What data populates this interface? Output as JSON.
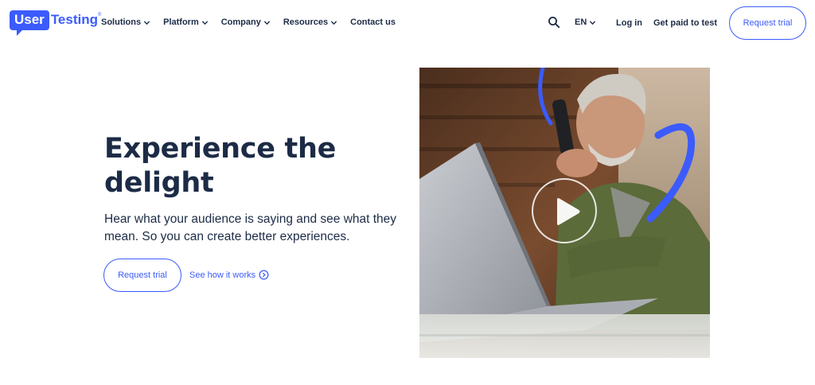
{
  "header": {
    "logo": {
      "part1": "User",
      "part2": "Testing",
      "reg": "®"
    },
    "nav": [
      {
        "label": "Solutions",
        "has_dropdown": true
      },
      {
        "label": "Platform",
        "has_dropdown": true
      },
      {
        "label": "Company",
        "has_dropdown": true
      },
      {
        "label": "Resources",
        "has_dropdown": true
      },
      {
        "label": "Contact us",
        "has_dropdown": false
      }
    ],
    "language": "EN",
    "login_label": "Log in",
    "get_paid_label": "Get paid to test",
    "cta_label": "Request trial"
  },
  "hero": {
    "headline": "Experience the delight",
    "subtext": "Hear what your audience is saying and see what they mean. So you can create better experiences.",
    "primary_cta": "Request trial",
    "secondary_link": "See how it works"
  },
  "colors": {
    "accent": "#3b5bfc",
    "text": "#1c2b46",
    "background": "#ffffff"
  },
  "icons": {
    "search": "search-icon",
    "chevron": "chevron-down-icon",
    "secondary_link": "circle-arrow-right-icon",
    "video": "play-icon"
  }
}
